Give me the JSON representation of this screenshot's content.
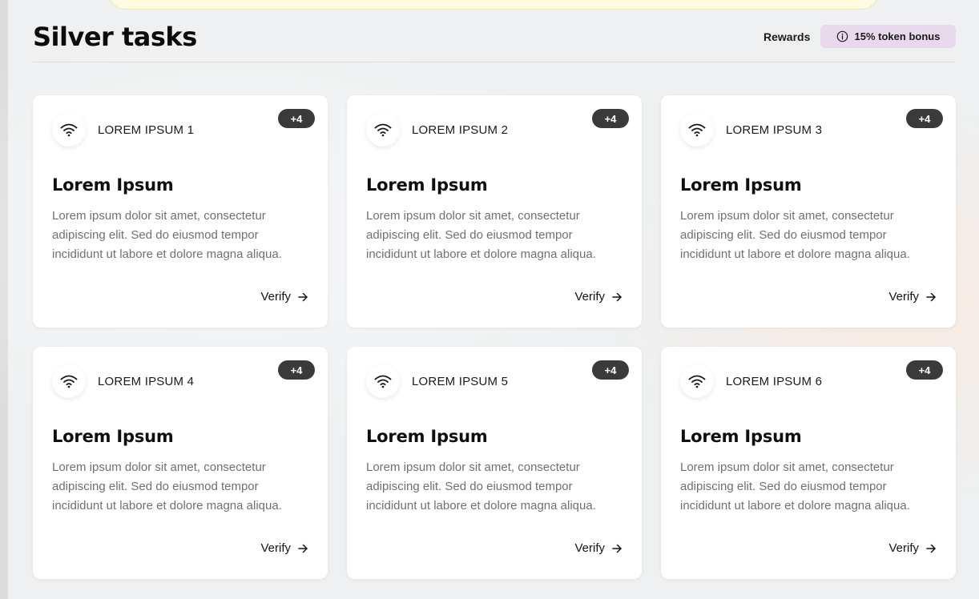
{
  "header": {
    "title": "Silver tasks",
    "rewards_label": "Rewards",
    "bonus_label": "15% token bonus",
    "bonus_icon": "info-circle-icon"
  },
  "cards": [
    {
      "category": "LOREM IPSUM 1",
      "points": "+4",
      "title": "Lorem Ipsum",
      "description": "Lorem ipsum dolor sit amet, consectetur adipiscing elit. Sed do eiusmod tempor incididunt ut labore et dolore magna aliqua.",
      "action": "Verify",
      "icon": "wifi-icon"
    },
    {
      "category": "LOREM IPSUM 2",
      "points": "+4",
      "title": "Lorem Ipsum",
      "description": "Lorem ipsum dolor sit amet, consectetur adipiscing elit. Sed do eiusmod tempor incididunt ut labore et dolore magna aliqua.",
      "action": "Verify",
      "icon": "wifi-icon"
    },
    {
      "category": "LOREM IPSUM 3",
      "points": "+4",
      "title": "Lorem Ipsum",
      "description": "Lorem ipsum dolor sit amet, consectetur adipiscing elit. Sed do eiusmod tempor incididunt ut labore et dolore magna aliqua.",
      "action": "Verify",
      "icon": "wifi-icon"
    },
    {
      "category": "LOREM IPSUM 4",
      "points": "+4",
      "title": "Lorem Ipsum",
      "description": "Lorem ipsum dolor sit amet, consectetur adipiscing elit. Sed do eiusmod tempor incididunt ut labore et dolore magna aliqua.",
      "action": "Verify",
      "icon": "wifi-icon"
    },
    {
      "category": "LOREM IPSUM 5",
      "points": "+4",
      "title": "Lorem Ipsum",
      "description": "Lorem ipsum dolor sit amet, consectetur adipiscing elit. Sed do eiusmod tempor incididunt ut labore et dolore magna aliqua.",
      "action": "Verify",
      "icon": "wifi-icon"
    },
    {
      "category": "LOREM IPSUM 6",
      "points": "+4",
      "title": "Lorem Ipsum",
      "description": "Lorem ipsum dolor sit amet, consectetur adipiscing elit. Sed do eiusmod tempor incididunt ut labore et dolore magna aliqua.",
      "action": "Verify",
      "icon": "wifi-icon"
    }
  ],
  "colors": {
    "badge_bg": "#3a3a3a",
    "bonus_bg": "#e8d9ec",
    "banner_bg": "#fffbe0"
  }
}
